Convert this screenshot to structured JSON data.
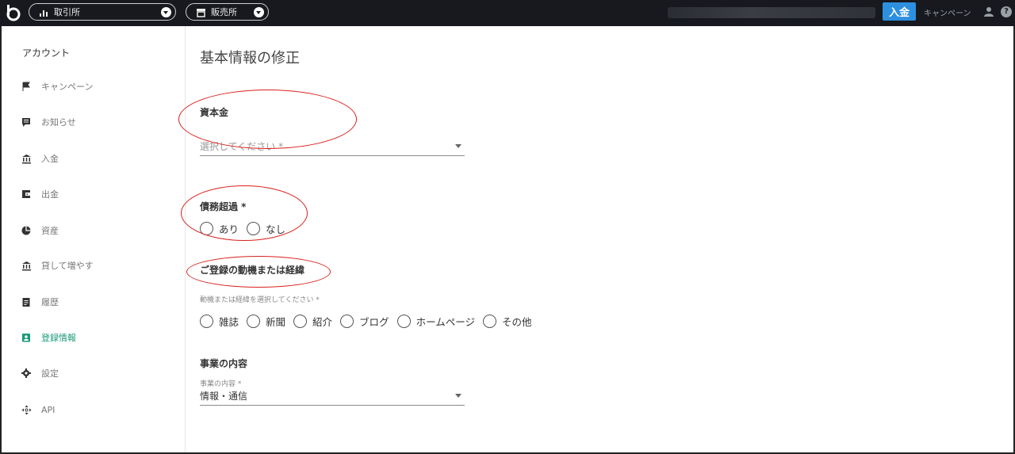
{
  "topbar": {
    "exchange_label": "取引所",
    "store_label": "販売所",
    "deposit_button": "入金",
    "campaign_link": "キャンペーン"
  },
  "sidebar": {
    "title": "アカウント",
    "items": [
      {
        "label": "キャンペーン",
        "icon": "flag-icon"
      },
      {
        "label": "お知らせ",
        "icon": "message-icon"
      },
      {
        "label": "入金",
        "icon": "bank-icon"
      },
      {
        "label": "出金",
        "icon": "wallet-icon"
      },
      {
        "label": "資産",
        "icon": "pie-chart-icon"
      },
      {
        "label": "貸して増やす",
        "icon": "bank-icon"
      },
      {
        "label": "履歴",
        "icon": "clipboard-icon"
      },
      {
        "label": "登録情報",
        "icon": "id-badge-icon",
        "active": true
      },
      {
        "label": "設定",
        "icon": "gear-icon"
      },
      {
        "label": "API",
        "icon": "api-icon"
      }
    ]
  },
  "main": {
    "title": "基本情報の修正",
    "capital": {
      "label": "資本金",
      "placeholder": "選択してください *"
    },
    "insolvency": {
      "label": "債務超過 *",
      "options": [
        "あり",
        "なし"
      ]
    },
    "motive": {
      "label": "ご登録の動機または経緯",
      "hint": "動機または経緯を選択してください *",
      "options": [
        "雑誌",
        "新聞",
        "紹介",
        "ブログ",
        "ホームページ",
        "その他"
      ]
    },
    "business": {
      "label": "事業の内容",
      "field_label": "事業の内容 *",
      "value": "情報・通信"
    }
  },
  "colors": {
    "topbar_bg": "#17191e",
    "accent_blue": "#2d8fe0",
    "active_green": "#1a9a7a",
    "annotation_red": "#d9201c"
  }
}
